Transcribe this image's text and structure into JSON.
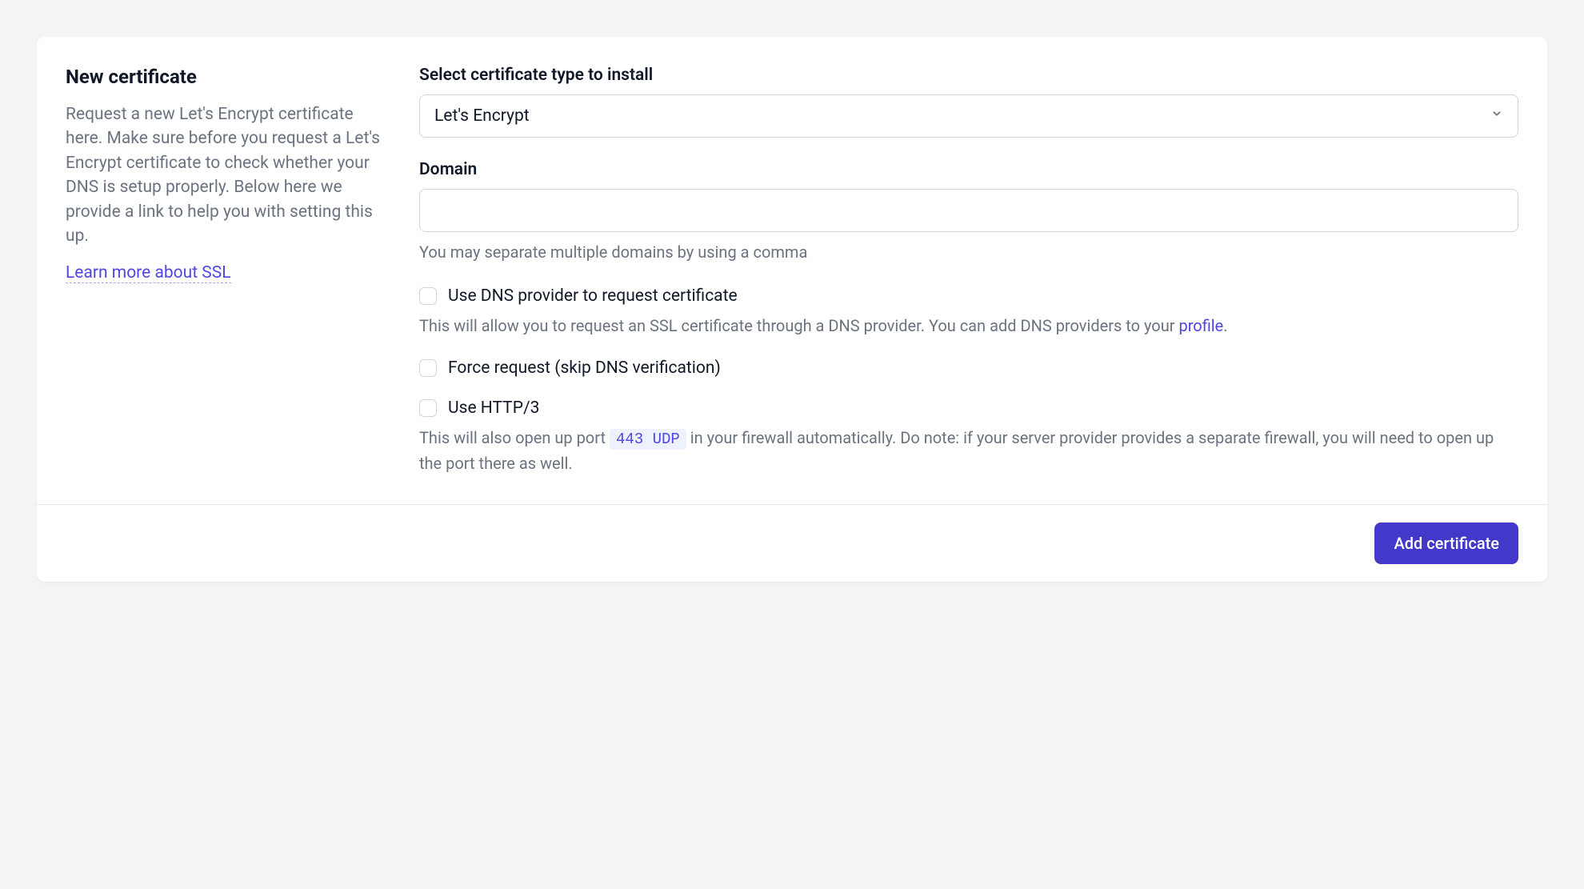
{
  "left": {
    "title": "New certificate",
    "description": "Request a new Let's Encrypt certificate here. Make sure before you request a Let's Encrypt certificate to check whether your DNS is setup properly. Below here we provide a link to help you with setting this up.",
    "learn_more": "Learn more about SSL"
  },
  "form": {
    "cert_type_label": "Select certificate type to install",
    "cert_type_value": "Let's Encrypt",
    "domain_label": "Domain",
    "domain_value": "",
    "domain_helper": "You may separate multiple domains by using a comma",
    "dns_provider_label": "Use DNS provider to request certificate",
    "dns_provider_helper_pre": "This will allow you to request an SSL certificate through a DNS provider. You can add DNS providers to your ",
    "dns_provider_link": "profile",
    "dns_provider_helper_post": ".",
    "force_request_label": "Force request (skip DNS verification)",
    "http3_label": "Use HTTP/3",
    "http3_helper_pre": "This will also open up port ",
    "http3_port_code": "443 UDP",
    "http3_helper_post": " in your firewall automatically. Do note: if your server provider provides a separate firewall, you will need to open up the port there as well."
  },
  "footer": {
    "submit_label": "Add certificate"
  }
}
